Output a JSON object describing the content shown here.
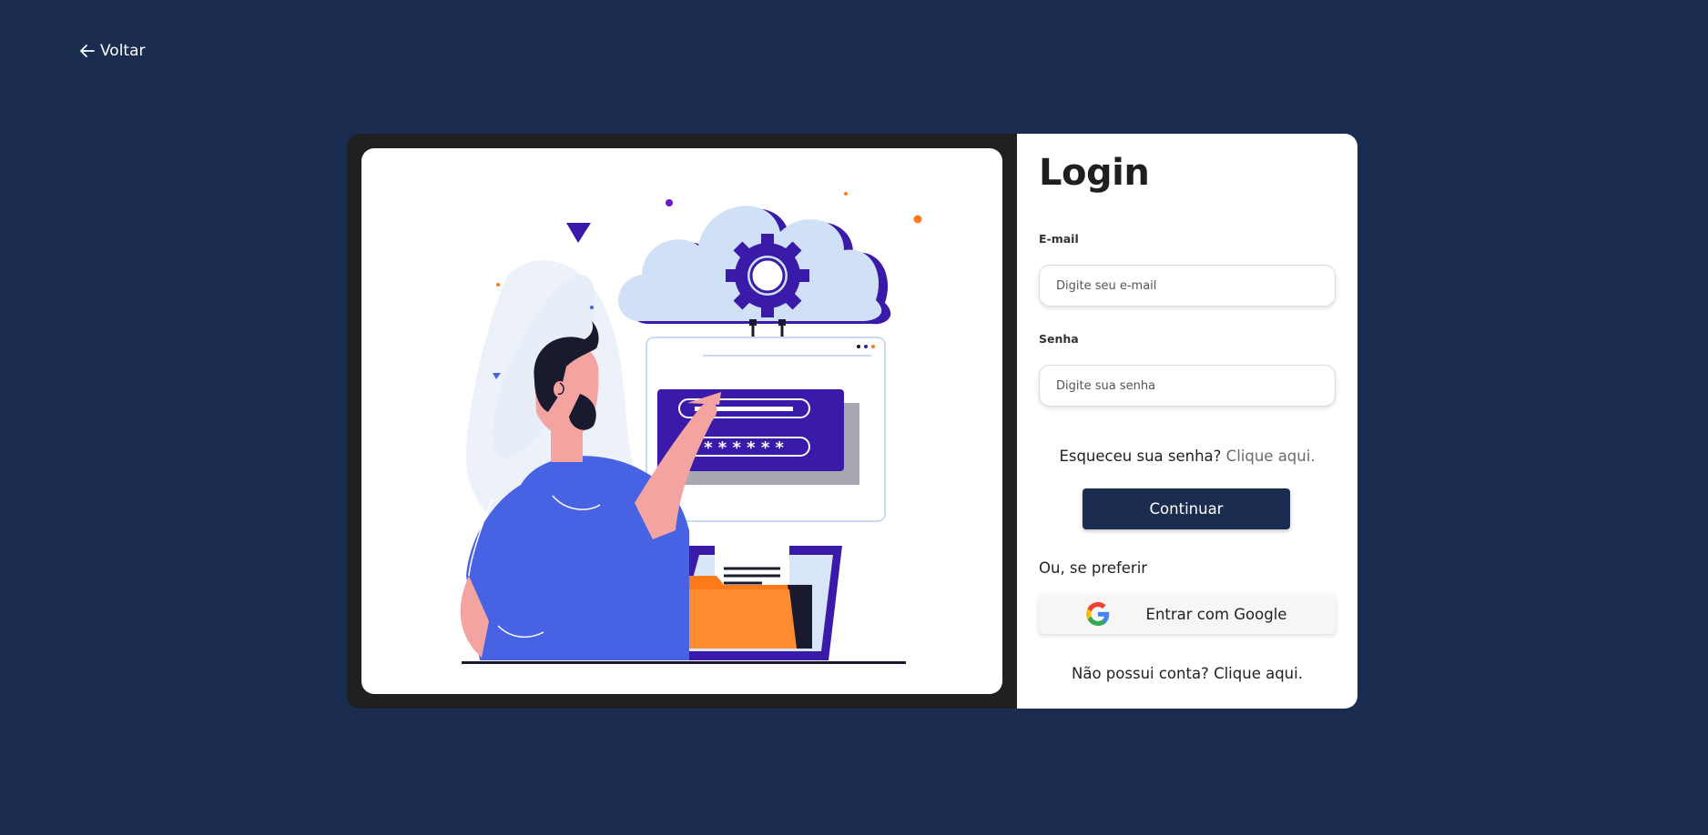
{
  "back": {
    "label": "Voltar",
    "icon": "arrow-left-icon"
  },
  "login": {
    "title": "Login",
    "email_label": "E-mail",
    "email_placeholder": "Digite seu e-mail",
    "email_value": "",
    "password_label": "Senha",
    "password_placeholder": "Digite sua senha",
    "password_value": "",
    "forgot_text": "Esqueceu sua senha?",
    "forgot_link": "Clique aqui.",
    "continue_label": "Continuar",
    "or_text": "Ou, se preferir",
    "google_label": "Entrar com Google",
    "google_icon": "google-logo-icon",
    "signup_text": "Não possui conta?",
    "signup_link": "Clique aqui."
  },
  "illustration": {
    "password_mask": "* * * * * *",
    "icons": [
      "cloud-icon",
      "gear-icon",
      "browser-window-icon",
      "login-form-icon",
      "laptop-icon",
      "folder-icon",
      "person-icon"
    ]
  },
  "colors": {
    "background": "#1a2d51",
    "card_dark": "#202020",
    "button_primary": "#1a2d51",
    "accent_purple": "#3a1aa8",
    "accent_blue": "#4763e4",
    "accent_orange": "#ff7a1a",
    "cloud": "#cfe0f7"
  }
}
